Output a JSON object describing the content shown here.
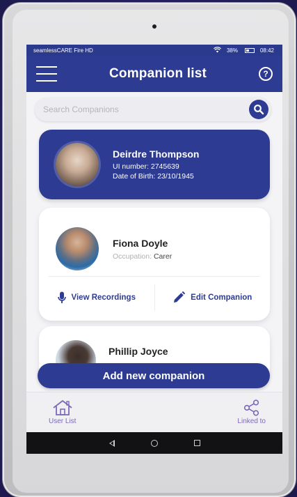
{
  "status": {
    "carrier": "seamlessCARE Fire HD",
    "battery": "38%",
    "time": "08:42"
  },
  "appbar": {
    "title": "Companion list",
    "help_symbol": "?"
  },
  "search": {
    "placeholder": "Search Companions",
    "value": ""
  },
  "selected_user": {
    "name": "Deirdre Thompson",
    "ui_number": "UI number: 2745639",
    "dob": "Date of Birth: 23/10/1945"
  },
  "companions": [
    {
      "name": "Fiona Doyle",
      "occupation_label": "Occupation:",
      "occupation_value": " Carer",
      "actions": {
        "view_recordings": "View Recordings",
        "edit_companion": "Edit Companion"
      }
    },
    {
      "name": "Phillip Joyce"
    }
  ],
  "add_button": "Add new companion",
  "bottom_nav": [
    {
      "label": "User List",
      "icon": "house-icon"
    },
    {
      "label": "Linked to",
      "icon": "share-icon"
    }
  ],
  "colors": {
    "primary": "#2d3b92",
    "nav_accent": "#7c68b8",
    "background": "#2a2568"
  }
}
